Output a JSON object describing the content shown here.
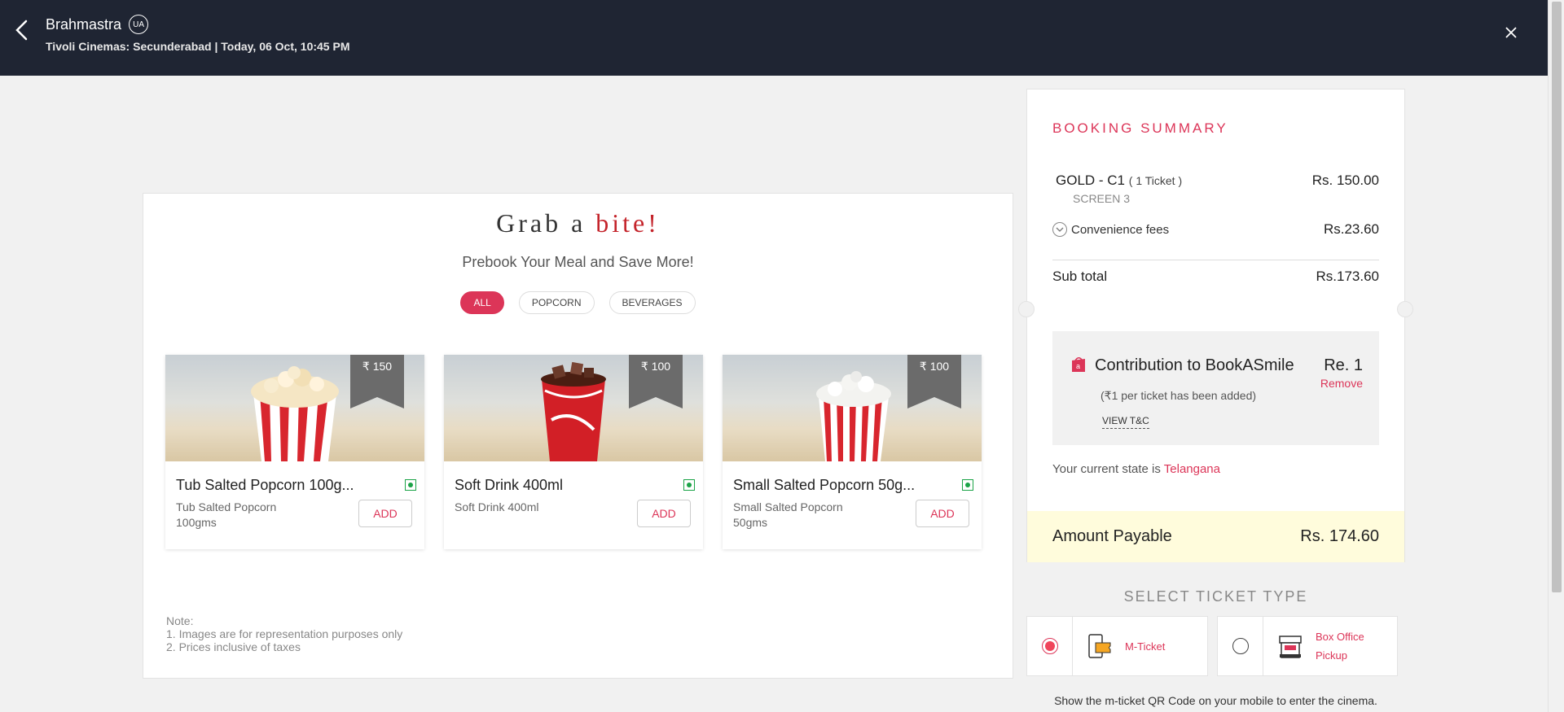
{
  "header": {
    "movie_title": "Brahmastra",
    "certificate": "UA",
    "show_info": "Tivoli Cinemas: Secunderabad | Today, 06 Oct, 10:45 PM"
  },
  "food": {
    "title_part1": "Grab a",
    "title_part2": "bite!",
    "subtitle": "Prebook Your Meal and Save More!",
    "filters": [
      {
        "label": "ALL",
        "active": true
      },
      {
        "label": "POPCORN",
        "active": false
      },
      {
        "label": "BEVERAGES",
        "active": false
      }
    ],
    "items": [
      {
        "name": "Tub Salted Popcorn 100g...",
        "desc_line1": "Tub Salted Popcorn",
        "desc_line2": "100gms",
        "price": "₹ 150",
        "add_label": "ADD",
        "image": "popcorn-tub-icon"
      },
      {
        "name": "Soft Drink 400ml",
        "desc_line1": "Soft Drink 400ml",
        "desc_line2": "",
        "price": "₹ 100",
        "add_label": "ADD",
        "image": "soft-drink-cup-icon"
      },
      {
        "name": "Small Salted Popcorn 50g...",
        "desc_line1": "Small Salted Popcorn",
        "desc_line2": "50gms",
        "price": "₹ 100",
        "add_label": "ADD",
        "image": "popcorn-small-icon"
      }
    ],
    "note_title": "Note:",
    "note_lines": [
      "1. Images are for representation purposes only",
      "2. Prices inclusive of taxes"
    ]
  },
  "summary": {
    "title": "BOOKING SUMMARY",
    "ticket_label": "GOLD - C1",
    "ticket_count": "( 1 Ticket )",
    "ticket_price": "Rs. 150.00",
    "screen": "SCREEN 3",
    "fee_label": "Convenience fees",
    "fee_price": "Rs.23.60",
    "subtotal_label": "Sub total",
    "subtotal_value": "Rs.173.60",
    "contribution": {
      "title": "Contribution to BookASmile",
      "amount": "Re. 1",
      "remove_label": "Remove",
      "note": "(₹1 per ticket has been added)",
      "tnc_label": "VIEW T&C"
    },
    "state_prefix": "Your current state is",
    "state_name": "Telangana",
    "payable_label": "Amount Payable",
    "payable_value": "Rs. 174.60"
  },
  "ticket_type": {
    "title": "SELECT TICKET TYPE",
    "options": [
      {
        "label": "M-Ticket",
        "selected": true
      },
      {
        "label_line1": "Box Office",
        "label_line2": "Pickup",
        "selected": false
      }
    ],
    "note": "Show the m-ticket QR Code on your mobile to enter the cinema."
  },
  "colors": {
    "header_bg": "#1f2533",
    "accent": "#dc3558",
    "veg_green": "#1ba347",
    "payable_bg": "#fffcdc"
  }
}
